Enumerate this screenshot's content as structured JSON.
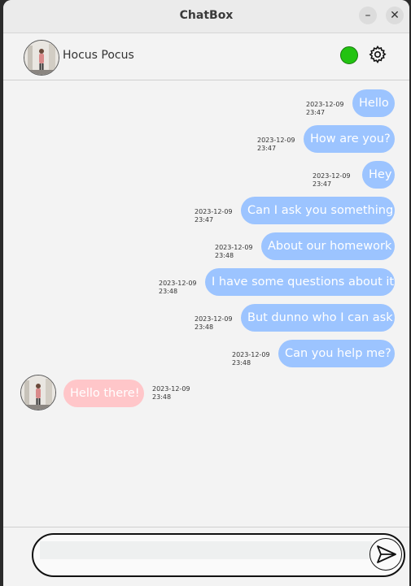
{
  "window": {
    "title": "ChatBox",
    "minimize_glyph": "–",
    "close_glyph": "✕"
  },
  "header": {
    "contact_name": "Hocus Pocus",
    "status_color": "#22c311"
  },
  "messages": [
    {
      "text": "Hello",
      "date": "2023-12-09",
      "time": "23:47",
      "from": "me"
    },
    {
      "text": "How are you?",
      "date": "2023-12-09",
      "time": "23:47",
      "from": "me"
    },
    {
      "text": "Hey",
      "date": "2023-12-09",
      "time": "23:47",
      "from": "me"
    },
    {
      "text": "Can I ask you something",
      "date": "2023-12-09",
      "time": "23:47",
      "from": "me"
    },
    {
      "text": "About our homework",
      "date": "2023-12-09",
      "time": "23:48",
      "from": "me"
    },
    {
      "text": "I have some questions about it",
      "date": "2023-12-09",
      "time": "23:48",
      "from": "me"
    },
    {
      "text": "But dunno who I can ask",
      "date": "2023-12-09",
      "time": "23:48",
      "from": "me"
    },
    {
      "text": "Can you help me?",
      "date": "2023-12-09",
      "time": "23:48",
      "from": "me"
    },
    {
      "text": "Hello there!",
      "date": "2023-12-09",
      "time": "23:48",
      "from": "contact"
    }
  ],
  "composer": {
    "value": "",
    "placeholder": ""
  },
  "colors": {
    "outgoing": "#9cc4ff",
    "incoming": "#ffc6c9"
  }
}
